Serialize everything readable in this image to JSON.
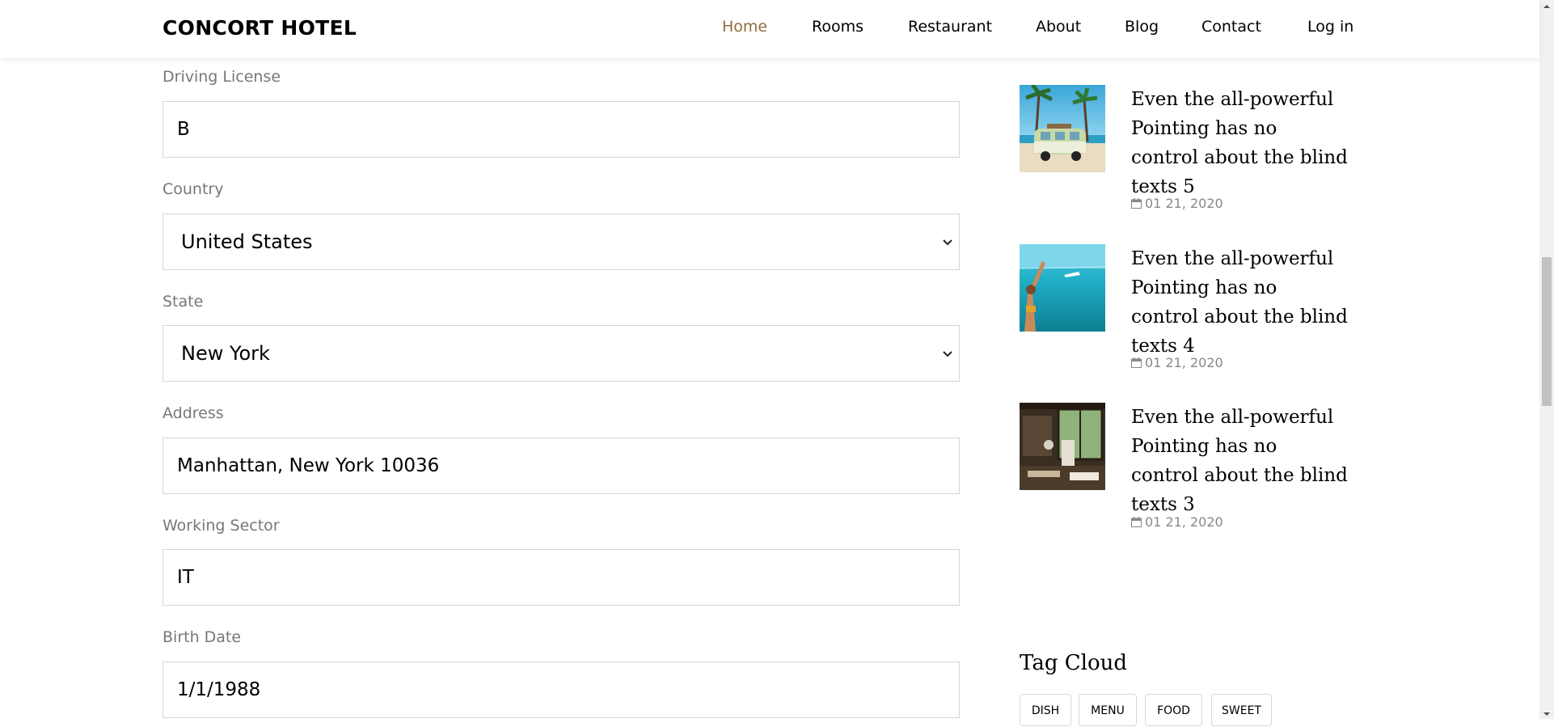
{
  "header": {
    "brand": "CONCORT HOTEL",
    "nav": [
      {
        "label": "Home",
        "active": true
      },
      {
        "label": "Rooms",
        "active": false
      },
      {
        "label": "Restaurant",
        "active": false
      },
      {
        "label": "About",
        "active": false
      },
      {
        "label": "Blog",
        "active": false
      },
      {
        "label": "Contact",
        "active": false
      },
      {
        "label": "Log in",
        "active": false
      }
    ],
    "accent_color": "#8d703b"
  },
  "form": {
    "fields": [
      {
        "label": "Driving License",
        "value": "B",
        "type": "text"
      },
      {
        "label": "Country",
        "value": "United States",
        "type": "select"
      },
      {
        "label": "State",
        "value": "New York",
        "type": "select"
      },
      {
        "label": "Address",
        "value": "Manhattan, New York 10036",
        "type": "text"
      },
      {
        "label": "Working Sector",
        "value": "IT",
        "type": "text"
      },
      {
        "label": "Birth Date",
        "value": "1/1/1988",
        "type": "text"
      }
    ]
  },
  "sidebar": {
    "posts": [
      {
        "title": "Even the all-powerful Pointing has no control about the blind texts 5",
        "date": "01 21, 2020",
        "image": "beach-van-photo"
      },
      {
        "title": "Even the all-powerful Pointing has no control about the blind texts 4",
        "date": "01 21, 2020",
        "image": "sea-swimmer-photo"
      },
      {
        "title": "Even the all-powerful Pointing has no control about the blind texts 3",
        "date": "01 21, 2020",
        "image": "room-interior-photo"
      }
    ],
    "tag_cloud": {
      "title": "Tag Cloud",
      "tags": [
        "DISH",
        "MENU",
        "FOOD",
        "SWEET"
      ]
    }
  }
}
